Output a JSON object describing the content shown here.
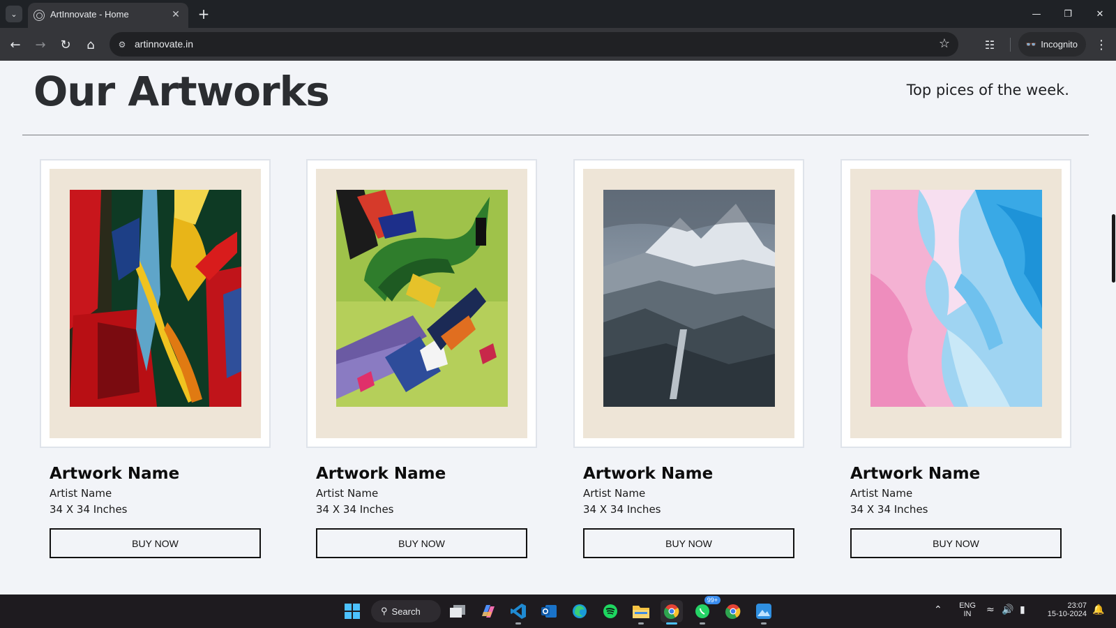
{
  "browser": {
    "tab_title": "ArtInnovate - Home",
    "url": "artinnovate.in",
    "incognito_label": "Incognito"
  },
  "header": {
    "title": "Our Artworks",
    "subtitle": "Top pices of the week."
  },
  "artworks": [
    {
      "name": "Artwork Name",
      "artist": "Artist Name",
      "size": "34 X 34 Inches",
      "button": "BUY NOW",
      "image": "abstract-red-yellow"
    },
    {
      "name": "Artwork Name",
      "artist": "Artist Name",
      "size": "34 X 34 Inches",
      "button": "BUY NOW",
      "image": "abstract-green"
    },
    {
      "name": "Artwork Name",
      "artist": "Artist Name",
      "size": "34 X 34 Inches",
      "button": "BUY NOW",
      "image": "mountain-landscape"
    },
    {
      "name": "Artwork Name",
      "artist": "Artist Name",
      "size": "34 X 34 Inches",
      "button": "BUY NOW",
      "image": "pink-blue-marble"
    }
  ],
  "taskbar": {
    "search_label": "Search",
    "whatsapp_badge": "99+",
    "language": "ENG",
    "region": "IN",
    "time": "23:07",
    "date": "15-10-2024"
  },
  "colors": {
    "page_bg": "#f2f4f8",
    "mat": "#eee5d7",
    "chrome_dark": "#1f2226"
  }
}
